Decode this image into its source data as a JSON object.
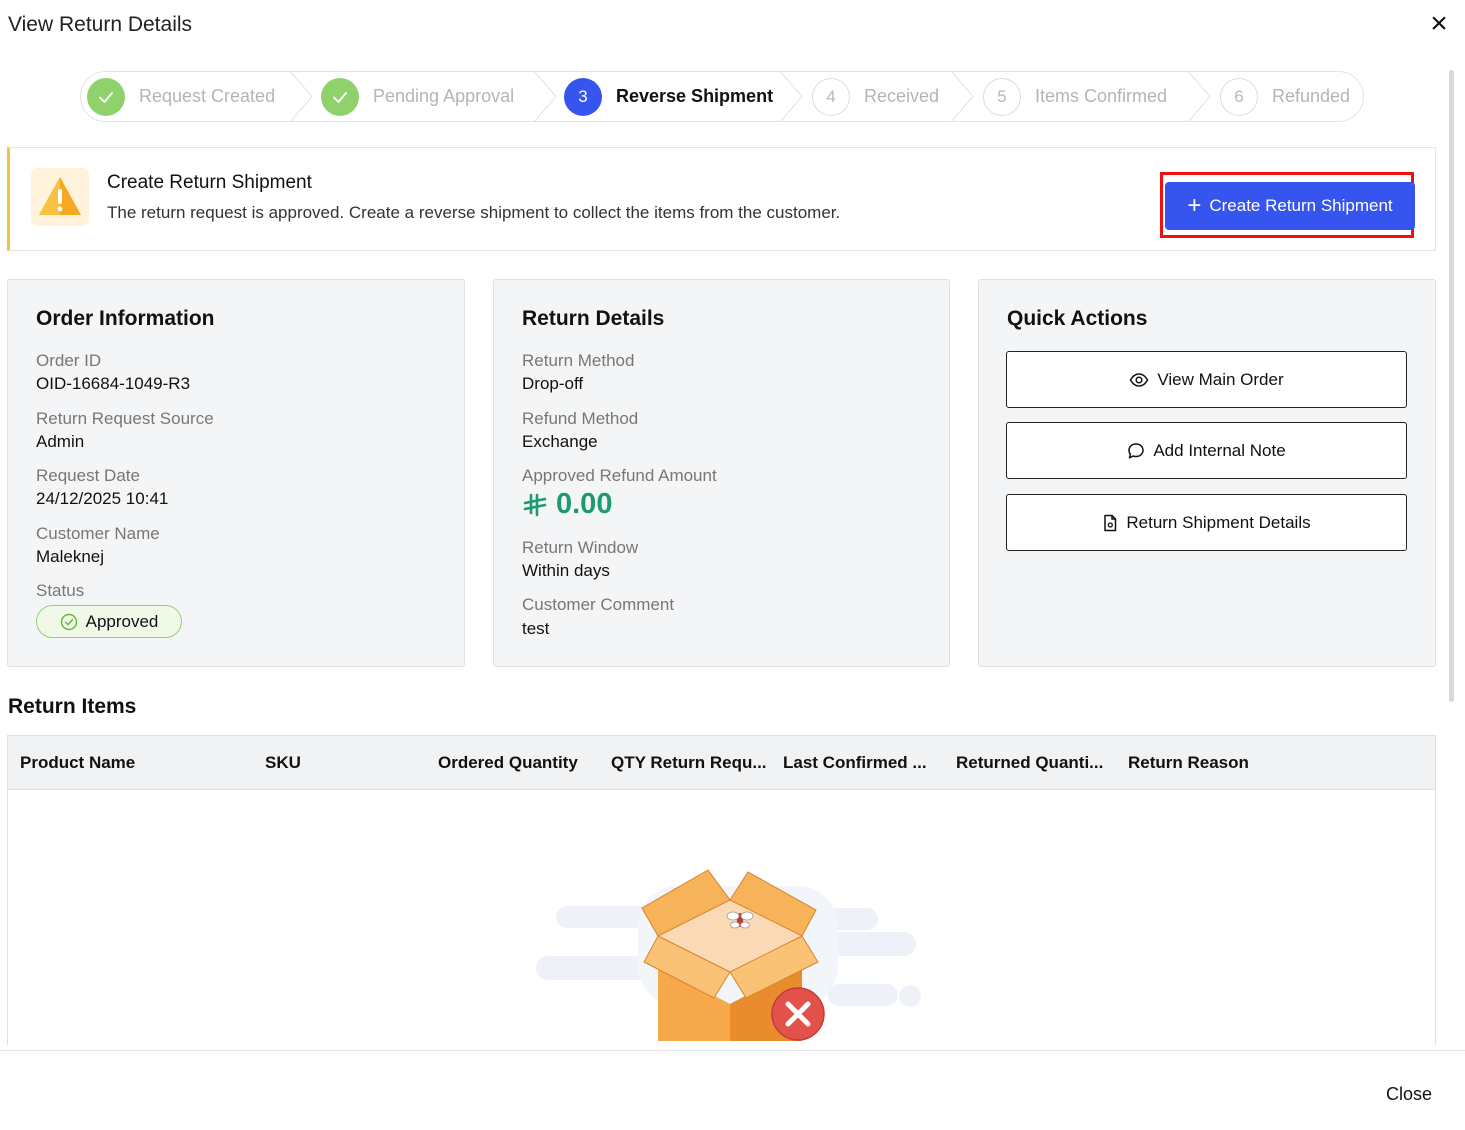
{
  "dialog": {
    "title": "View Return Details",
    "close_icon": "×"
  },
  "stepper": {
    "steps": [
      {
        "number": "",
        "label": "Request Created",
        "state": "done"
      },
      {
        "number": "",
        "label": "Pending Approval",
        "state": "done"
      },
      {
        "number": "3",
        "label": "Reverse Shipment",
        "state": "active"
      },
      {
        "number": "4",
        "label": "Received",
        "state": "pending"
      },
      {
        "number": "5",
        "label": "Items Confirmed",
        "state": "pending"
      },
      {
        "number": "6",
        "label": "Refunded",
        "state": "pending"
      }
    ]
  },
  "alert": {
    "title": "Create Return Shipment",
    "description": "The return request is approved. Create a reverse shipment to collect the items from the customer.",
    "button_label": "Create Return Shipment",
    "icon": "warning-icon"
  },
  "order_info": {
    "title": "Order Information",
    "fields": [
      {
        "label": "Order ID",
        "value": "OID-16684-1049-R3"
      },
      {
        "label": "Return Request Source",
        "value": "Admin"
      },
      {
        "label": "Request Date",
        "value": "24/12/2025 10:41"
      },
      {
        "label": "Customer Name",
        "value": "Maleknej"
      }
    ],
    "status_label": "Status",
    "status_value": "Approved"
  },
  "return_details": {
    "title": "Return Details",
    "return_method_label": "Return Method",
    "return_method_value": "Drop-off",
    "refund_method_label": "Refund Method",
    "refund_method_value": "Exchange",
    "approved_amount_label": "Approved Refund Amount",
    "approved_amount_value": "0.00",
    "return_window_label": "Return Window",
    "return_window_value": "Within days",
    "customer_comment_label": "Customer Comment",
    "customer_comment_value": "test"
  },
  "quick_actions": {
    "title": "Quick Actions",
    "buttons": [
      {
        "label": "View Main Order",
        "icon": "eye-icon"
      },
      {
        "label": "Add Internal Note",
        "icon": "chat-bubble-icon"
      },
      {
        "label": "Return Shipment Details",
        "icon": "document-icon"
      }
    ]
  },
  "return_items": {
    "title": "Return Items",
    "columns": [
      "Product Name",
      "SKU",
      "Ordered Quantity",
      "QTY Return Requ...",
      "Last Confirmed ...",
      "Returned Quanti...",
      "Return Reason"
    ],
    "rows": []
  },
  "footer": {
    "close_label": "Close"
  },
  "colors": {
    "primary": "#3555ee",
    "success": "#8fd16a",
    "amount": "#1d9b6c",
    "warning": "#f5c33b",
    "highlight": "#ee1111"
  }
}
